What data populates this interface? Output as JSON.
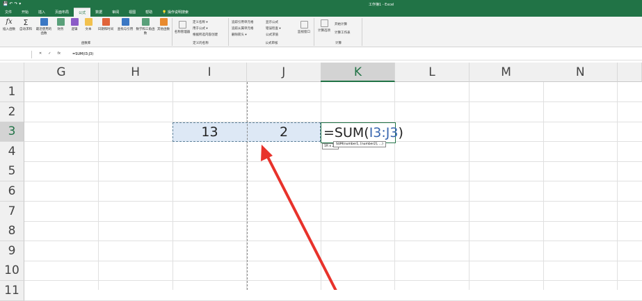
{
  "window": {
    "title": "工作簿1 - Excel",
    "quick_access": "💾 ↶ ↷ ▾"
  },
  "tabs": [
    "文件",
    "开始",
    "插入",
    "页面布局",
    "公式",
    "数据",
    "审阅",
    "视图",
    "帮助",
    "💡 操作说明搜索"
  ],
  "ribbon": {
    "function_library": {
      "label": "函数库",
      "buttons": [
        "插入函数",
        "自动求和",
        "最近使用的函数",
        "财务",
        "逻辑",
        "文本",
        "日期和时间",
        "查找与引用",
        "数学和三角函数",
        "其他函数"
      ]
    },
    "defined_names": {
      "label": "定义的名称",
      "big": "名称管理器",
      "items": [
        "定义名称 ▾",
        "用于公式 ▾",
        "根据所选内容创建"
      ]
    },
    "formula_auditing": {
      "label": "公式审核",
      "items": [
        "追踪引用单元格",
        "追踪从属单元格",
        "删除箭头 ▾",
        "显示公式",
        "错误检查 ▾",
        "公式求值"
      ],
      "watch": "监视窗口"
    },
    "calculation": {
      "label": "计算",
      "options": "计算选项",
      "items": [
        "开始计算",
        "计算工作表"
      ]
    }
  },
  "formula_bar": {
    "name_box": "",
    "cancel": "✕",
    "enter": "✓",
    "fx": "fx",
    "formula": "=SUM(I3:J3)"
  },
  "columns": [
    "G",
    "H",
    "I",
    "J",
    "K",
    "L",
    "M",
    "N"
  ],
  "rows": [
    "1",
    "2",
    "3",
    "4",
    "5",
    "6",
    "7",
    "8",
    "9",
    "10",
    "11"
  ],
  "cells": {
    "I3": "13",
    "J3": "2",
    "K3_prefix": "=SUM(",
    "K3_ref": "I3:J3",
    "K3_suffix": ")"
  },
  "tooltip": {
    "size": "1R x 2C",
    "hint": "SUM(number1, [number2], ...)"
  },
  "colors": {
    "accent": "#217346",
    "ref": "#3a67b0",
    "arrow": "#e8322b"
  }
}
